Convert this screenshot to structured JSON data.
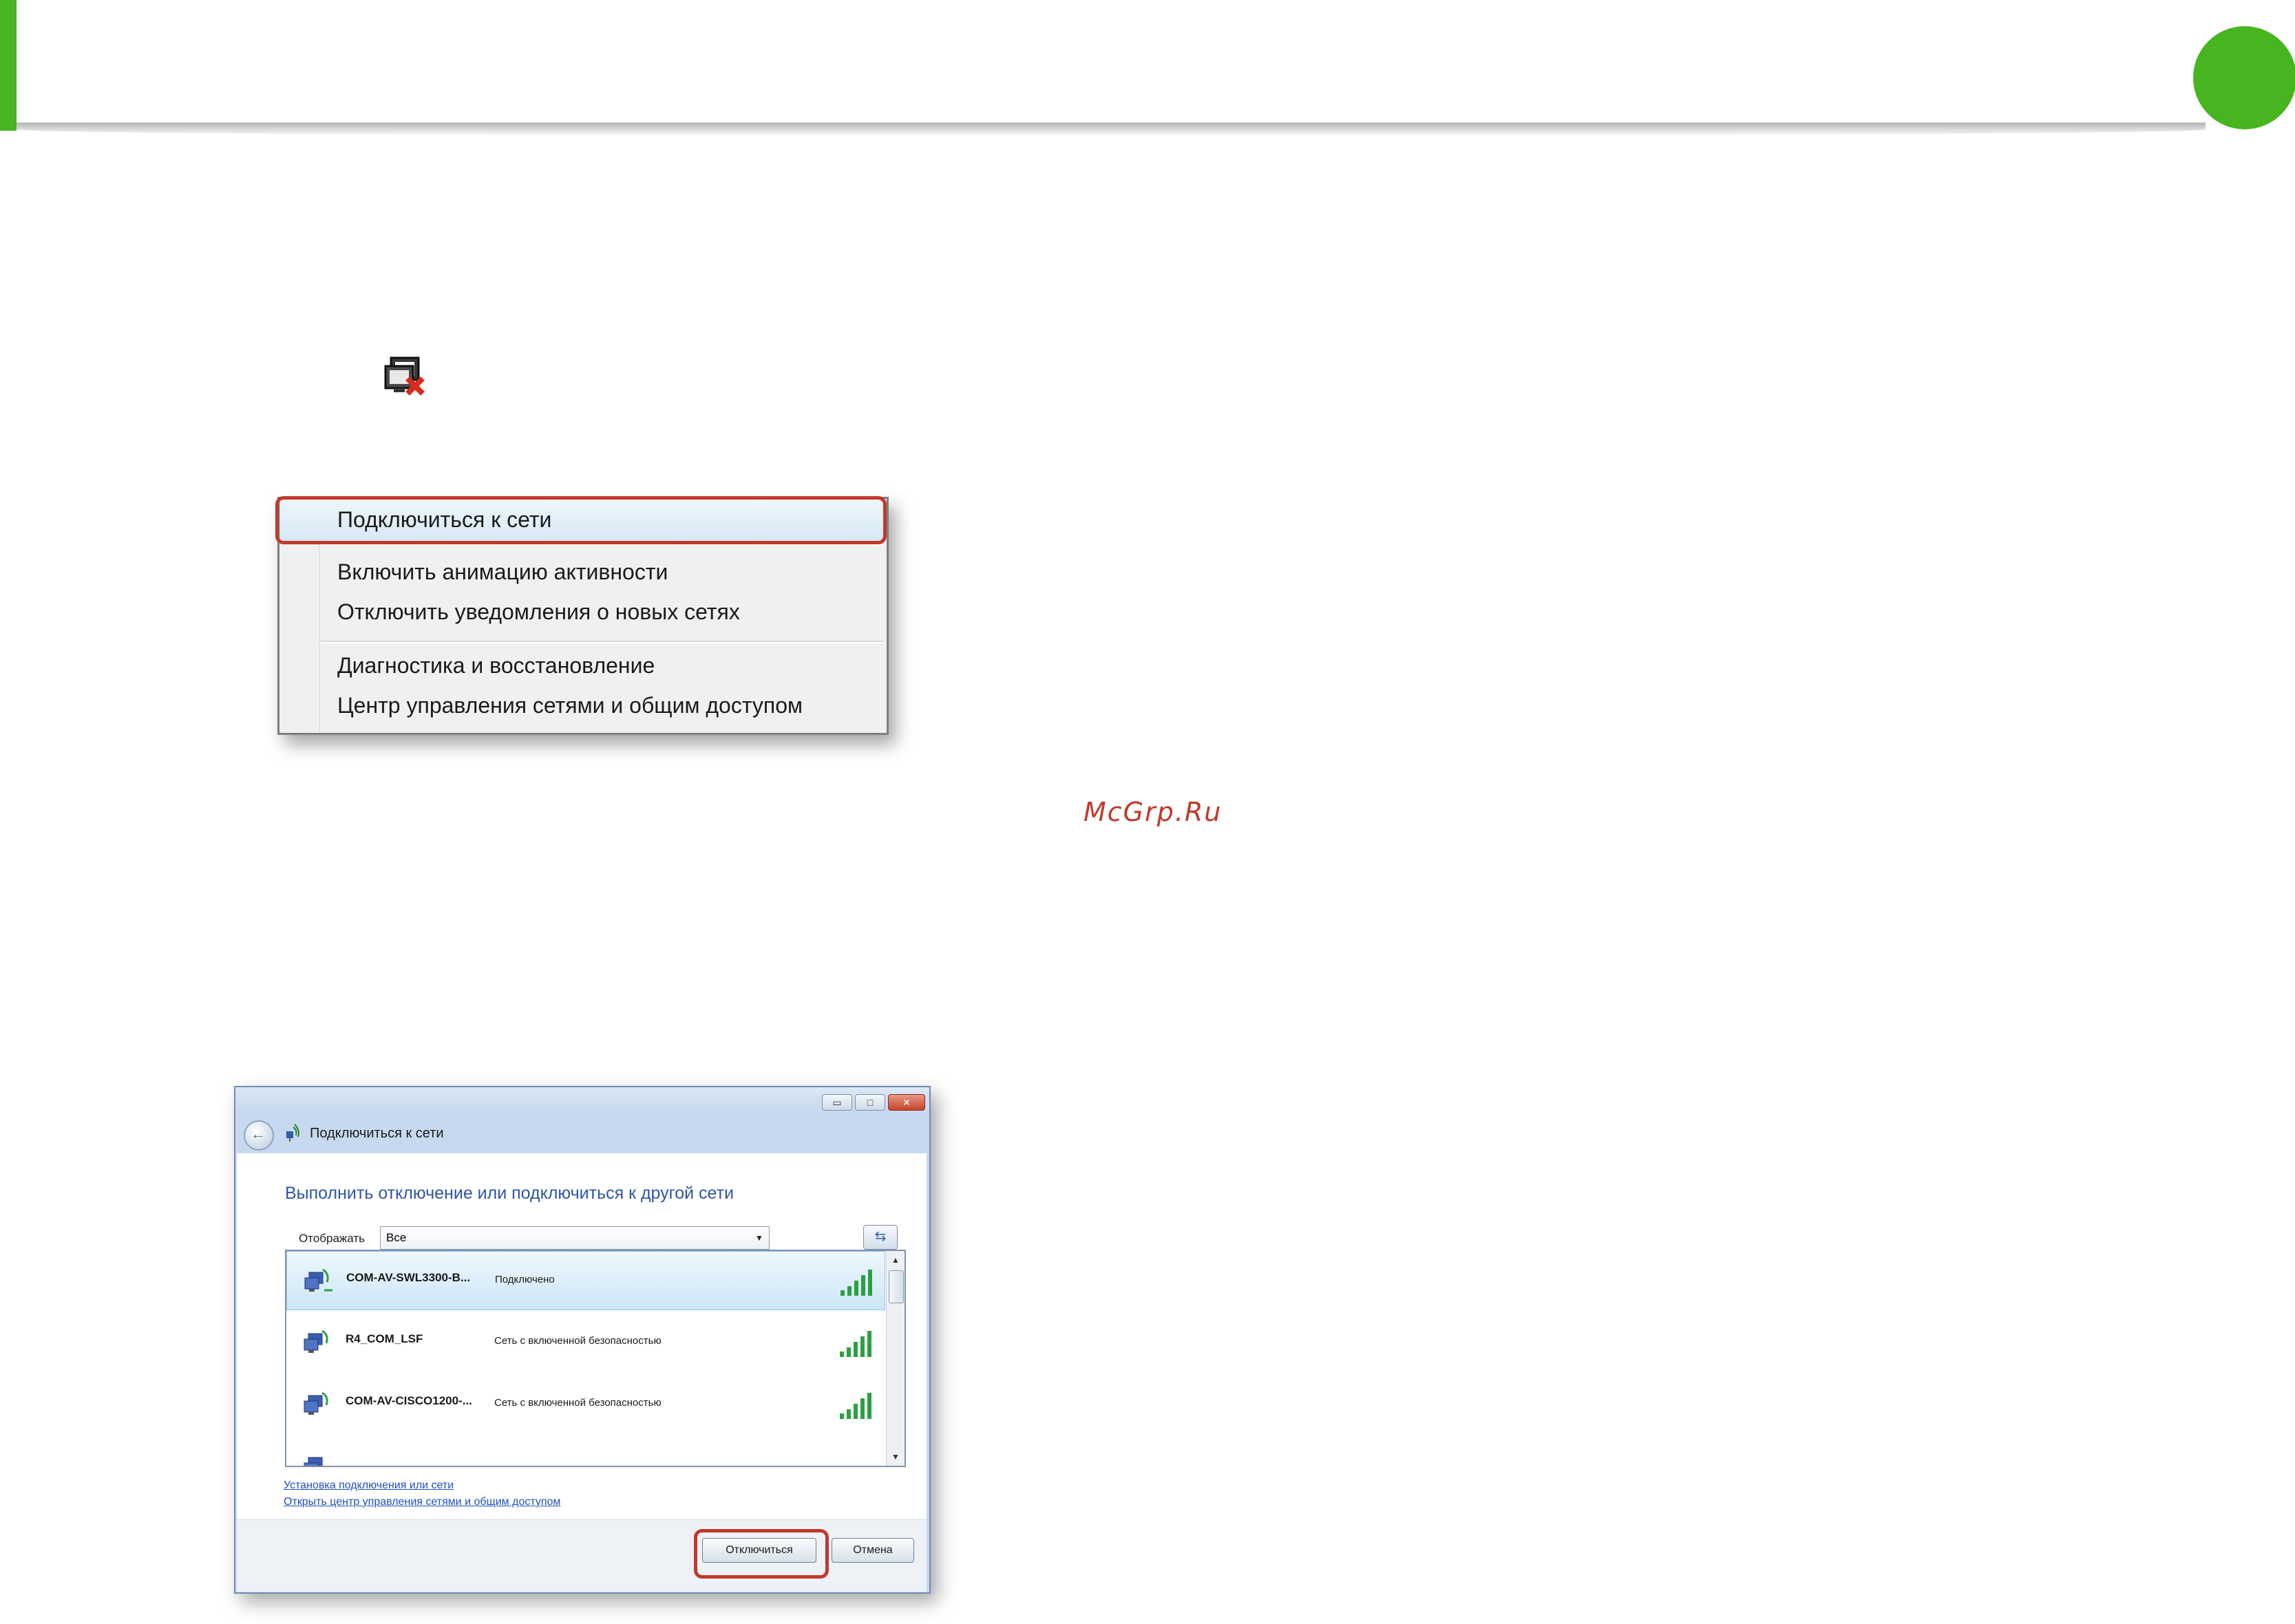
{
  "page": {
    "watermark": "McGrp.Ru",
    "colors": {
      "accent_green": "#46b51f",
      "highlight_red": "#c0392b",
      "link_blue": "#1f4fbf"
    },
    "tray_icon": "network-disconnected-icon"
  },
  "context_menu": {
    "items": [
      "Подключиться к сети",
      "Включить анимацию активности",
      "Отключить уведомления о новых сетях",
      "Диагностика и восстановление",
      "Центр управления сетями и общим доступом"
    ]
  },
  "dialog": {
    "window_title": "Подключиться к сети",
    "window_buttons": {
      "minimize": "▭",
      "maximize": "□",
      "close": "✕"
    },
    "heading": "Выполнить отключение или подключиться к другой сети",
    "show_label": "Отображать",
    "show_value": "Все",
    "refresh_icon": "refresh-icon",
    "networks": [
      {
        "name": "COM-AV-SWL3300-B...",
        "status": "Подключено",
        "signal": 5
      },
      {
        "name": "R4_COM_LSF",
        "status": "Сеть с включенной безопасностью",
        "signal": 5
      },
      {
        "name": "COM-AV-CISCO1200-...",
        "status": "Сеть с включенной безопасностью",
        "signal": 5
      }
    ],
    "links": [
      "Установка подключения или сети",
      "Открыть центр управления сетями и общим доступом"
    ],
    "buttons": {
      "disconnect": "Отключиться",
      "cancel": "Отмена"
    }
  }
}
